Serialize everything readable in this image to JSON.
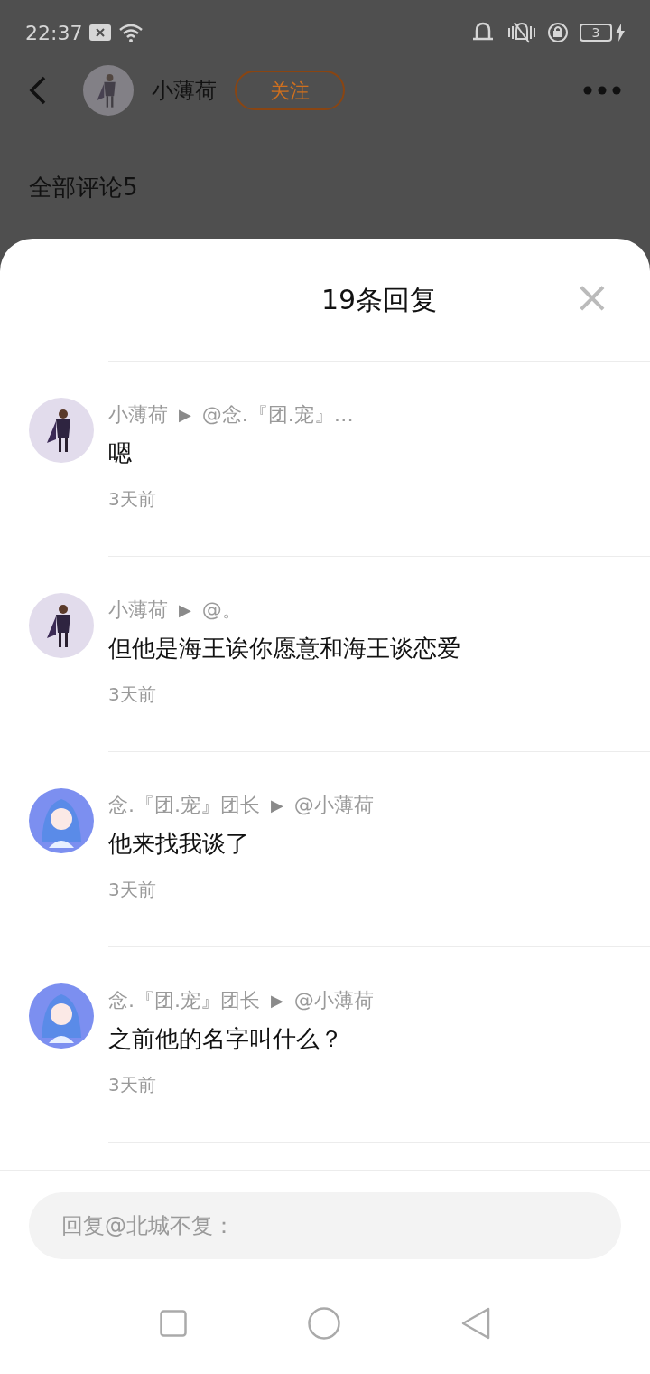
{
  "status_bar": {
    "time": "22:37",
    "battery": "3"
  },
  "header": {
    "user_name": "小薄荷",
    "follow_button": "关注"
  },
  "section_title": "全部评论5",
  "sheet": {
    "title": "19条回复",
    "close": "×",
    "replies": [
      {
        "kind": "dark",
        "author": "小薄荷",
        "arrow": "▶",
        "target": "@念.『团.宠』…",
        "content": "嗯",
        "time": "3天前"
      },
      {
        "kind": "dark",
        "author": "小薄荷",
        "arrow": "▶",
        "target": "@。",
        "content": "但他是海王诶你愿意和海王谈恋爱",
        "time": "3天前"
      },
      {
        "kind": "blue",
        "author": "念.『团.宠』团长",
        "arrow": "▶",
        "target": "@小薄荷",
        "content": "他来找我谈了",
        "time": "3天前"
      },
      {
        "kind": "blue",
        "author": "念.『团.宠』团长",
        "arrow": "▶",
        "target": "@小薄荷",
        "content": "之前他的名字叫什么？",
        "time": "3天前"
      }
    ],
    "reply_field": {
      "placeholder": "回复@北城不复："
    }
  }
}
